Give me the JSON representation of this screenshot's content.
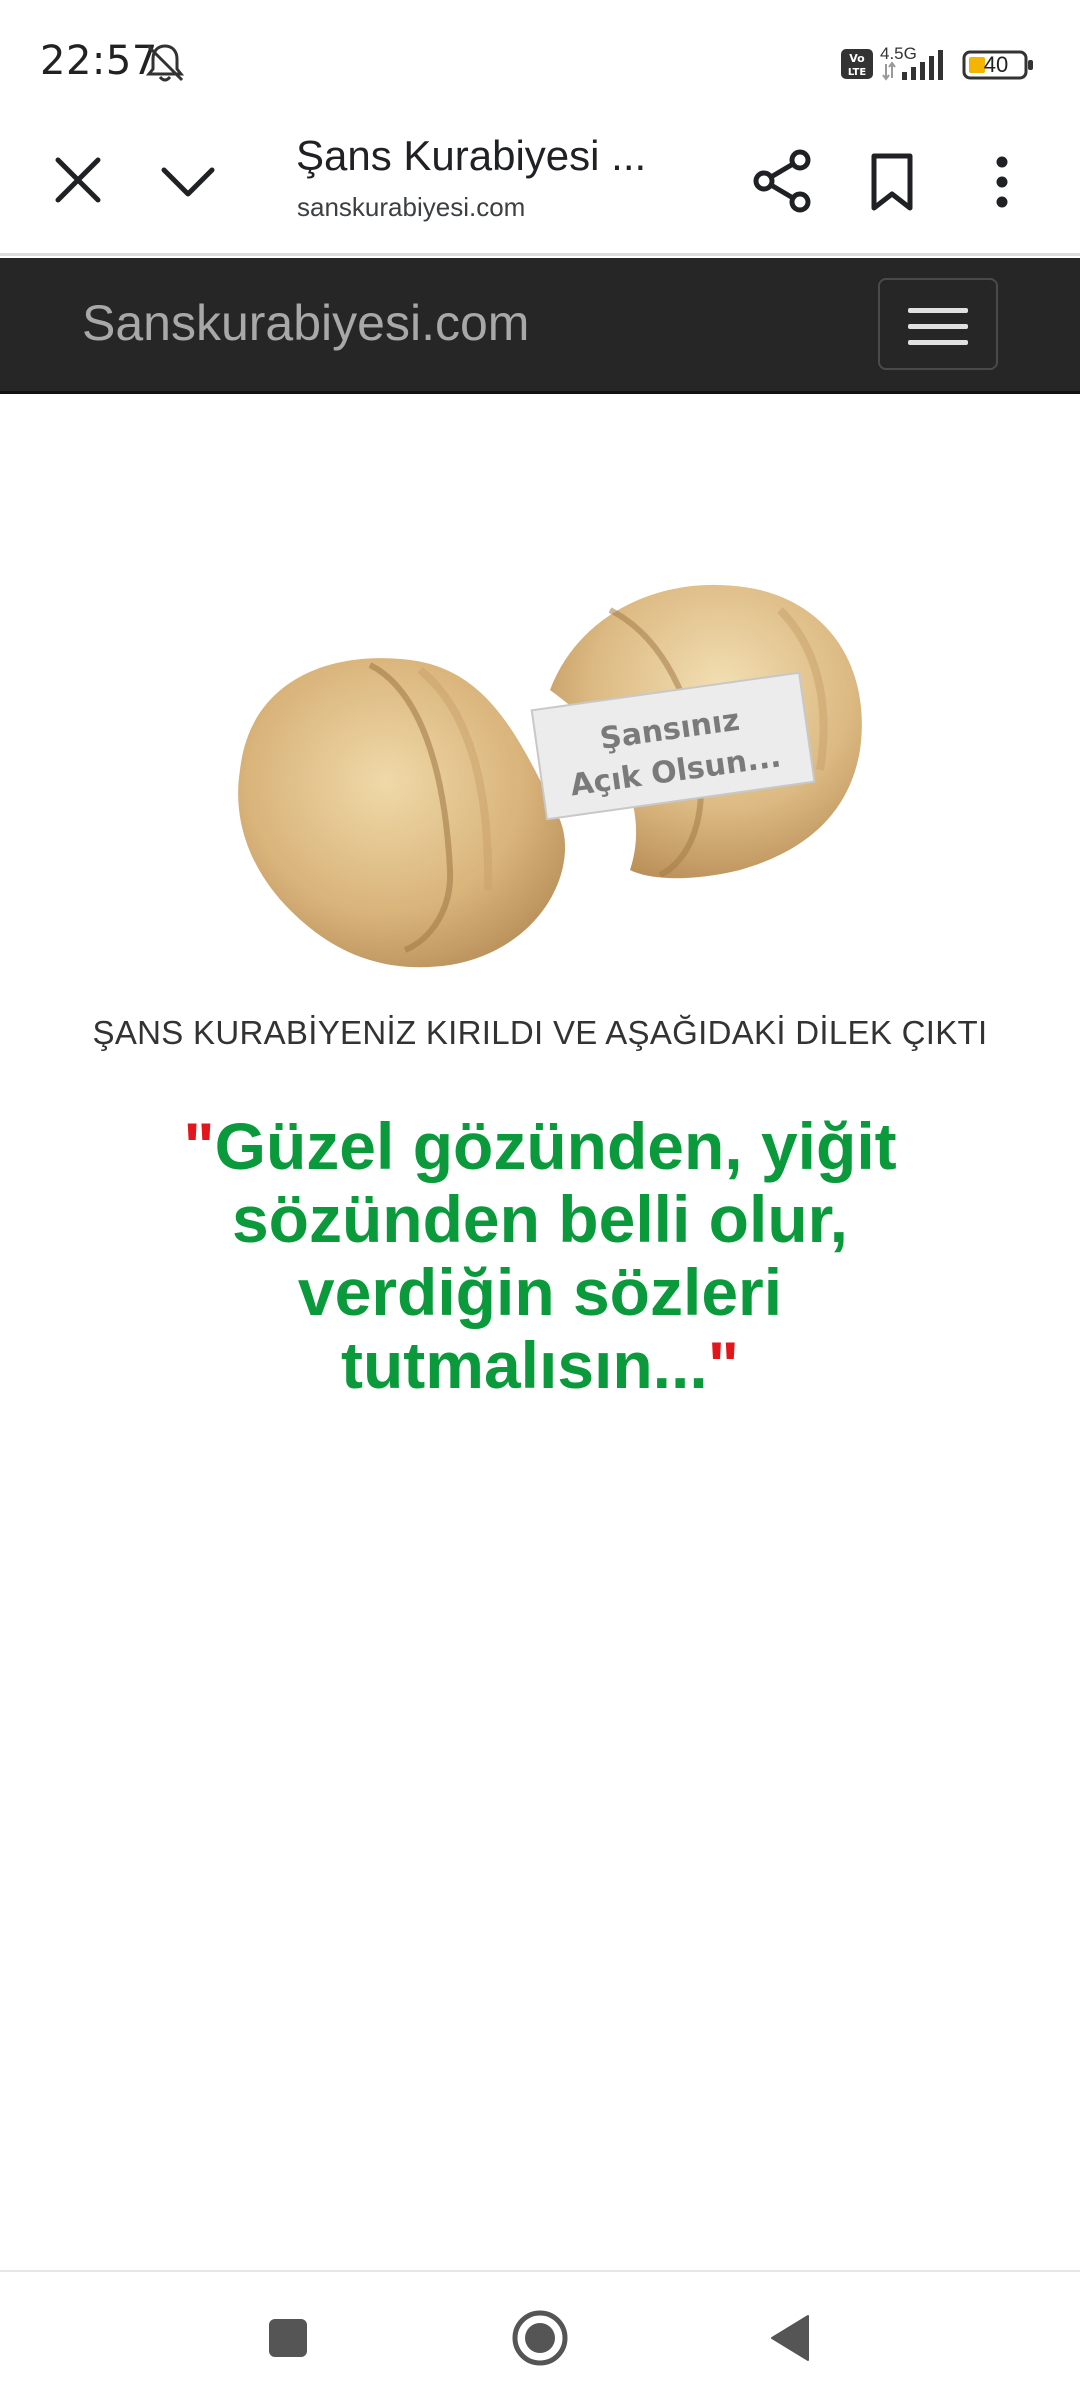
{
  "status_bar": {
    "time": "22:57",
    "network_label": "4.5G",
    "battery_level": "40",
    "icons": [
      "bell-off-icon",
      "volte-icon",
      "signal-icon",
      "battery-icon"
    ]
  },
  "browser": {
    "title": "Şans Kurabiyesi ...",
    "url": "sanskurabiyesi.com",
    "icons": [
      "close-icon",
      "chevron-down-icon",
      "share-icon",
      "bookmark-icon",
      "more-vert-icon"
    ]
  },
  "site": {
    "brand": "Sanskurabiyesi.com",
    "menu_icon": "hamburger-menu-icon",
    "navbar_color": "#262626"
  },
  "content": {
    "cookie_paper_line1": "Şansınız",
    "cookie_paper_line2": "Açık Olsun...",
    "heading": "ŞANS KURABİYENİZ KIRILDI VE AŞAĞIDAKİ DİLEK ÇIKTI",
    "quote_open": "\"",
    "quote_text": "Güzel gözünden, yiğit sözünden belli olur, verdiğin sözleri tutmalısın...",
    "quote_close": "\"",
    "quote_color": "#0b9a3b",
    "quote_mark_color": "#e3161c"
  },
  "nav_bar": {
    "icons": [
      "recents-square-icon",
      "home-circle-icon",
      "back-triangle-icon"
    ]
  }
}
